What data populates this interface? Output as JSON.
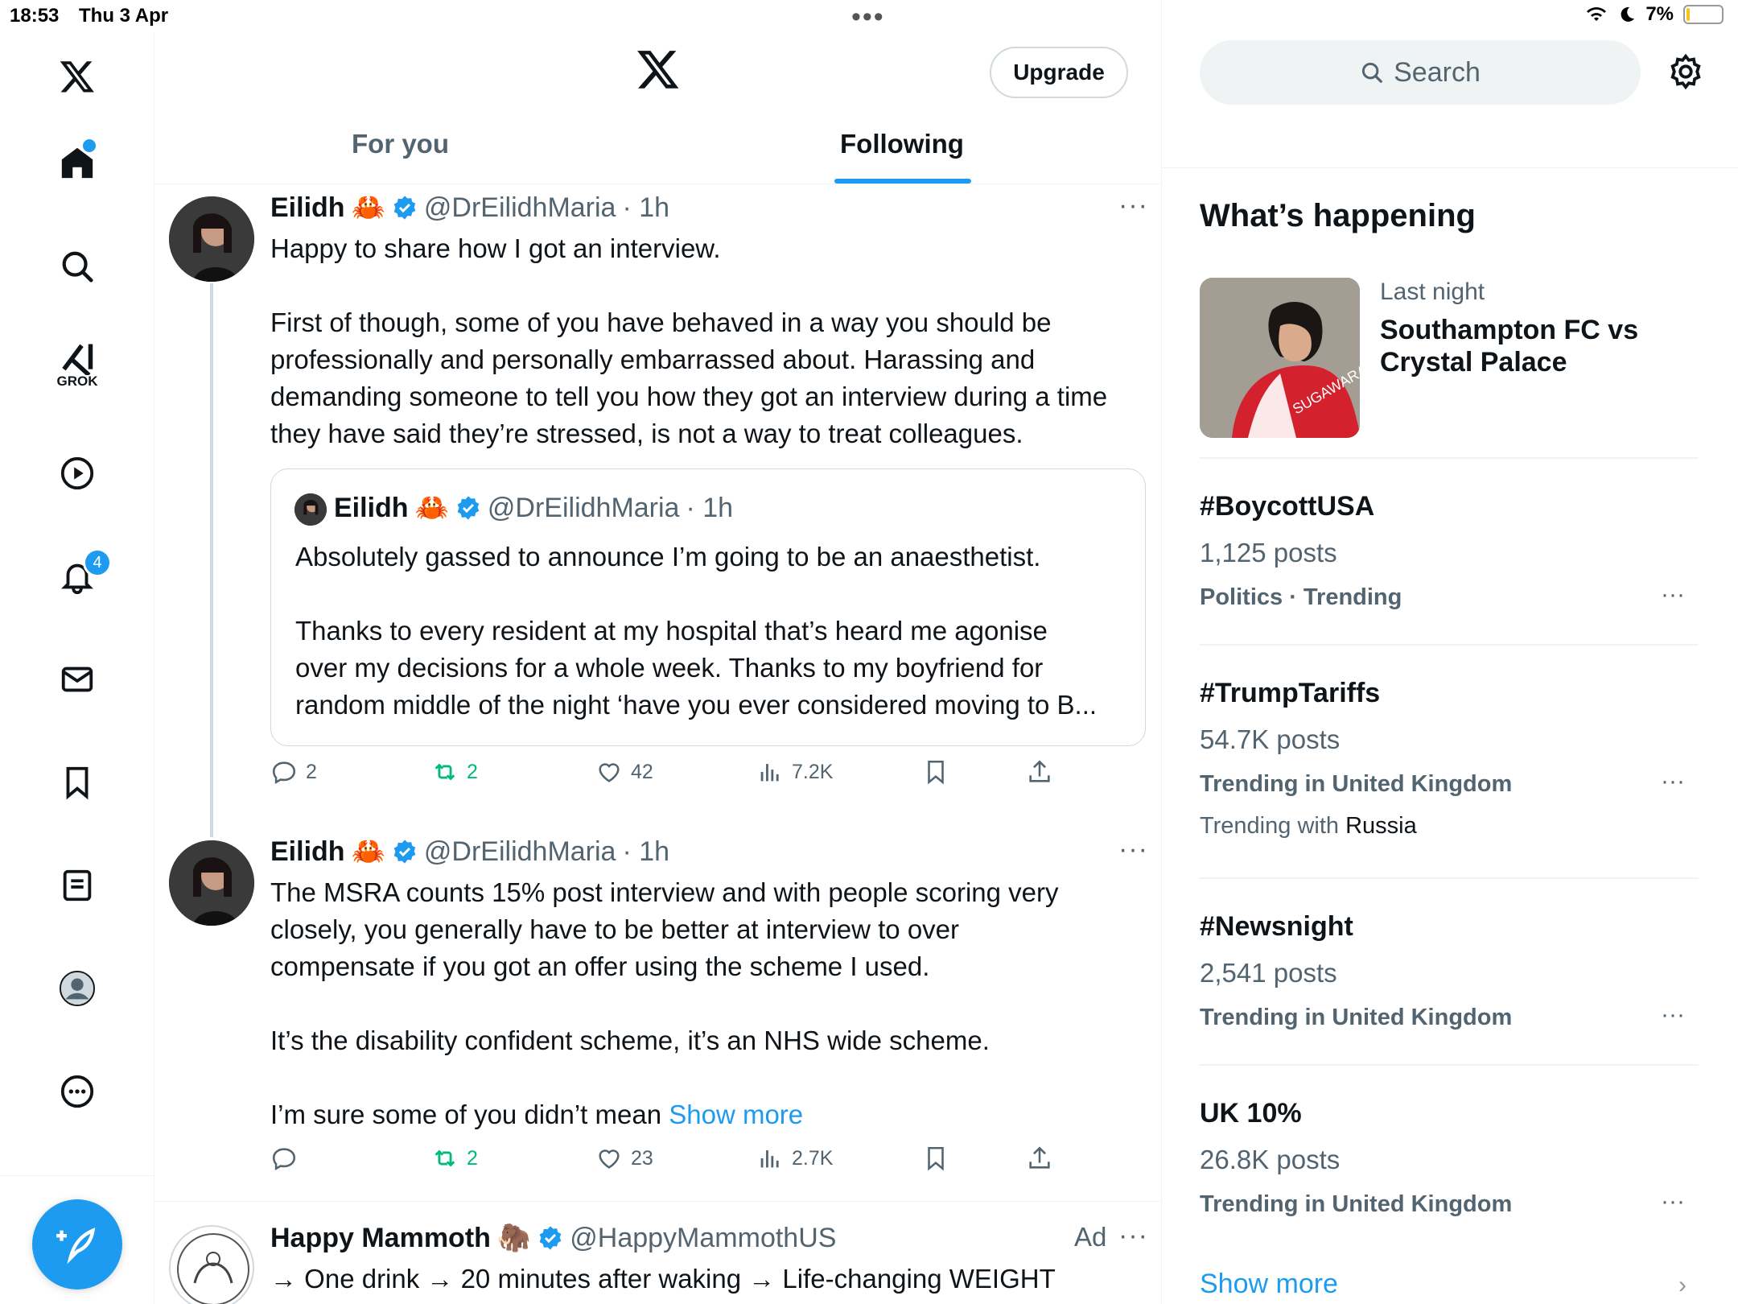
{
  "status_bar": {
    "time": "18:53",
    "date": "Thu 3 Apr",
    "battery": "7%"
  },
  "sidebar": {
    "notification_count": "4",
    "grok_label": "GROK",
    "items": [
      "home-icon",
      "search-icon",
      "grok-icon",
      "video-icon",
      "notifications-icon",
      "messages-icon",
      "bookmarks-icon",
      "lists-icon",
      "profile-icon",
      "more-icon"
    ]
  },
  "header": {
    "upgrade_label": "Upgrade",
    "tabs": [
      {
        "label": "For you",
        "active": false
      },
      {
        "label": "Following",
        "active": true
      }
    ]
  },
  "tweets": [
    {
      "name": "Eilidh",
      "emoji": "🦀",
      "handle": "@DrEilidhMaria",
      "time": "· 1h",
      "text": "Happy to share how I got an interview.\n\nFirst of though, some of you have behaved in a way you should be\nprofessionally and personally embarrassed about. Harassing and\ndemanding someone to tell you how they got an interview during a time\nthey have said they’re stressed, is not a way to treat colleagues.",
      "quote": {
        "name": "Eilidh",
        "emoji": "🦀",
        "handle": "@DrEilidhMaria",
        "time": "· 1h",
        "text": "Absolutely gassed to announce I’m going to be an anaesthetist.\n\nThanks to every resident at my hospital that’s heard me agonise\nover my decisions for a whole week. Thanks to my boyfriend for\nrandom middle of the night ‘have you ever considered moving to B..."
      },
      "replies": "2",
      "retweets": "2",
      "likes": "42",
      "views": "7.2K"
    },
    {
      "name": "Eilidh",
      "emoji": "🦀",
      "handle": "@DrEilidhMaria",
      "time": "· 1h",
      "text": "The MSRA counts 15% post interview and with people scoring very\nclosely, you generally have to be better at interview to over\ncompensate if you got an offer using the scheme I used.\n\nIt’s the disability confident scheme, it’s an NHS wide scheme.\n\nI’m sure some of you didn’t mean ",
      "show_more": "Show more",
      "replies": "",
      "retweets": "2",
      "likes": "23",
      "views": "2.7K"
    },
    {
      "name": "Happy Mammoth",
      "emoji": "🦣",
      "handle": "@HappyMammothUS",
      "ad_label": "Ad",
      "text": "→ One drink → 20 minutes after waking → Life-changing WEIGHT"
    }
  ],
  "right": {
    "search_placeholder": "Search",
    "heading": "What’s happening",
    "news": {
      "time": "Last night",
      "title_line1": "Southampton FC vs",
      "title_line2": "Crystal Palace",
      "jersey_text": "SUGAWARA"
    },
    "trends": [
      {
        "title": "#BoycottUSA",
        "posts": "1,125 posts",
        "meta": "Politics · Trending"
      },
      {
        "title": "#TrumpTariffs",
        "posts": "54.7K posts",
        "meta": "Trending in United Kingdom",
        "with_prefix": "Trending with ",
        "with_value": "Russia"
      },
      {
        "title": "#Newsnight",
        "posts": "2,541 posts",
        "meta": "Trending in United Kingdom"
      },
      {
        "title": "UK 10%",
        "posts": "26.8K posts",
        "meta": "Trending in United Kingdom"
      }
    ],
    "show_more": "Show more"
  },
  "colors": {
    "accent": "#1d9bf0",
    "retweet": "#00ba7c",
    "muted": "#536471",
    "text": "#0f1419"
  }
}
